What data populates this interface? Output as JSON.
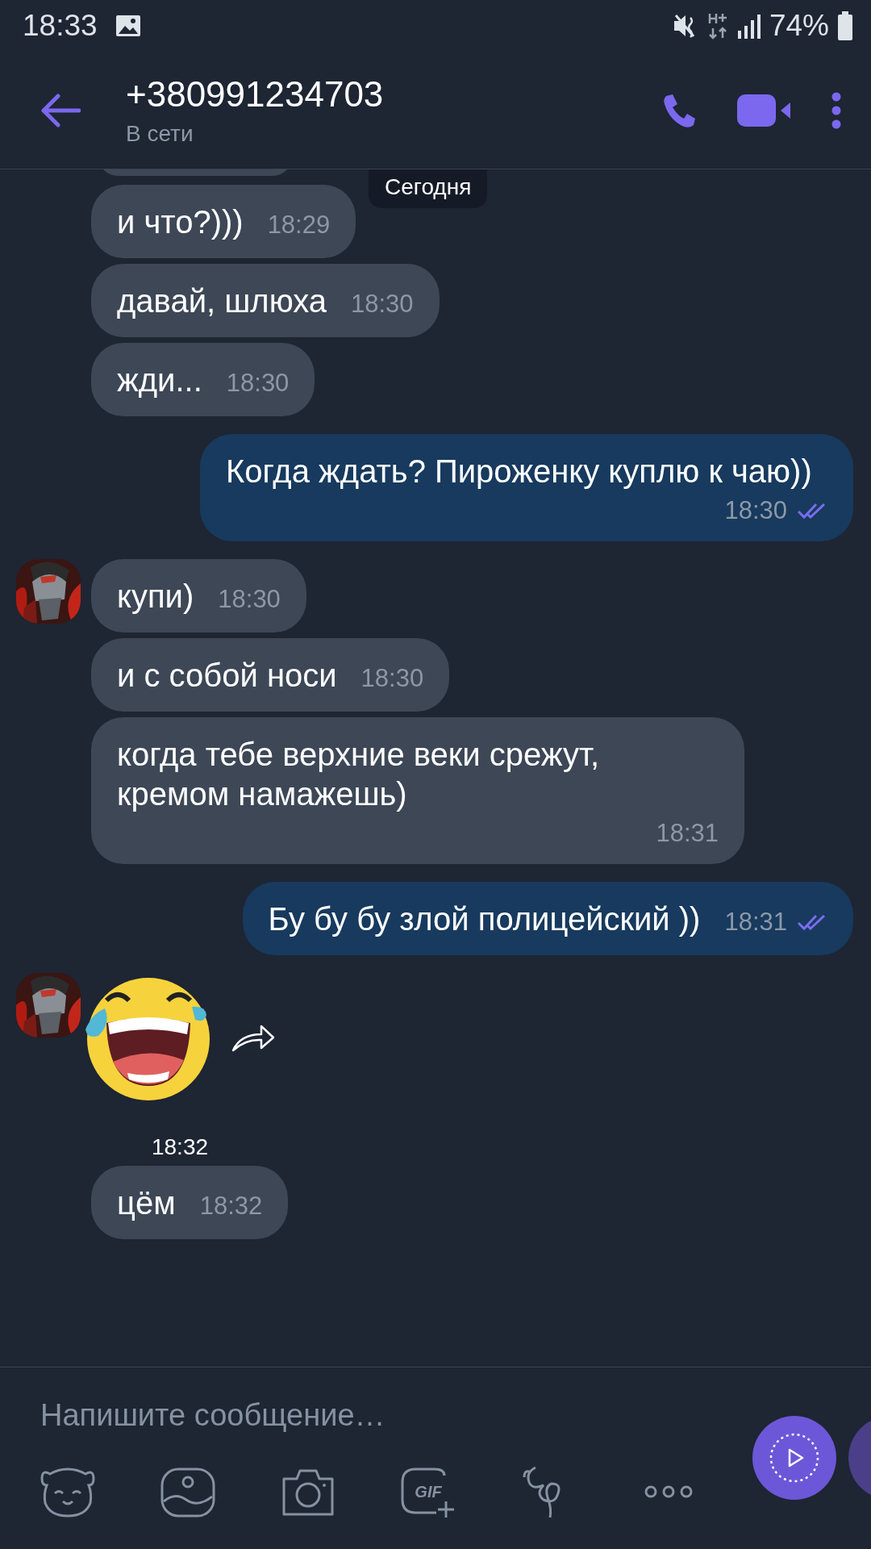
{
  "status_bar": {
    "time": "18:33",
    "battery": "74%"
  },
  "header": {
    "title": "+380991234703",
    "subtitle": "В сети"
  },
  "date_badge": "Сегодня",
  "messages": [
    {
      "kind": "incoming",
      "text": "и что?)))",
      "time": "18:29",
      "avatar": false
    },
    {
      "kind": "incoming",
      "text": "давай, шлюха",
      "time": "18:30",
      "avatar": false
    },
    {
      "kind": "incoming",
      "text": "жди...",
      "time": "18:30",
      "avatar": false
    },
    {
      "kind": "outgoing",
      "text": "Когда ждать? Пироженку куплю к чаю))",
      "time": "18:30",
      "read": true
    },
    {
      "kind": "incoming",
      "text": "купи)",
      "time": "18:30",
      "avatar": true
    },
    {
      "kind": "incoming",
      "text": "и с собой носи",
      "time": "18:30",
      "avatar": false
    },
    {
      "kind": "incoming",
      "text": "когда тебе верхние веки срежут, кремом намажешь)",
      "time": "18:31",
      "avatar": false
    },
    {
      "kind": "outgoing",
      "text": "Бу бу бу злой полицейский ))",
      "time": "18:31",
      "read": true
    },
    {
      "kind": "sticker",
      "time": "18:32",
      "avatar": true
    },
    {
      "kind": "incoming",
      "text": "цём",
      "time": "18:32",
      "avatar": false
    }
  ],
  "composer": {
    "placeholder": "Напишите сообщение…",
    "gif_label": "GIF"
  }
}
